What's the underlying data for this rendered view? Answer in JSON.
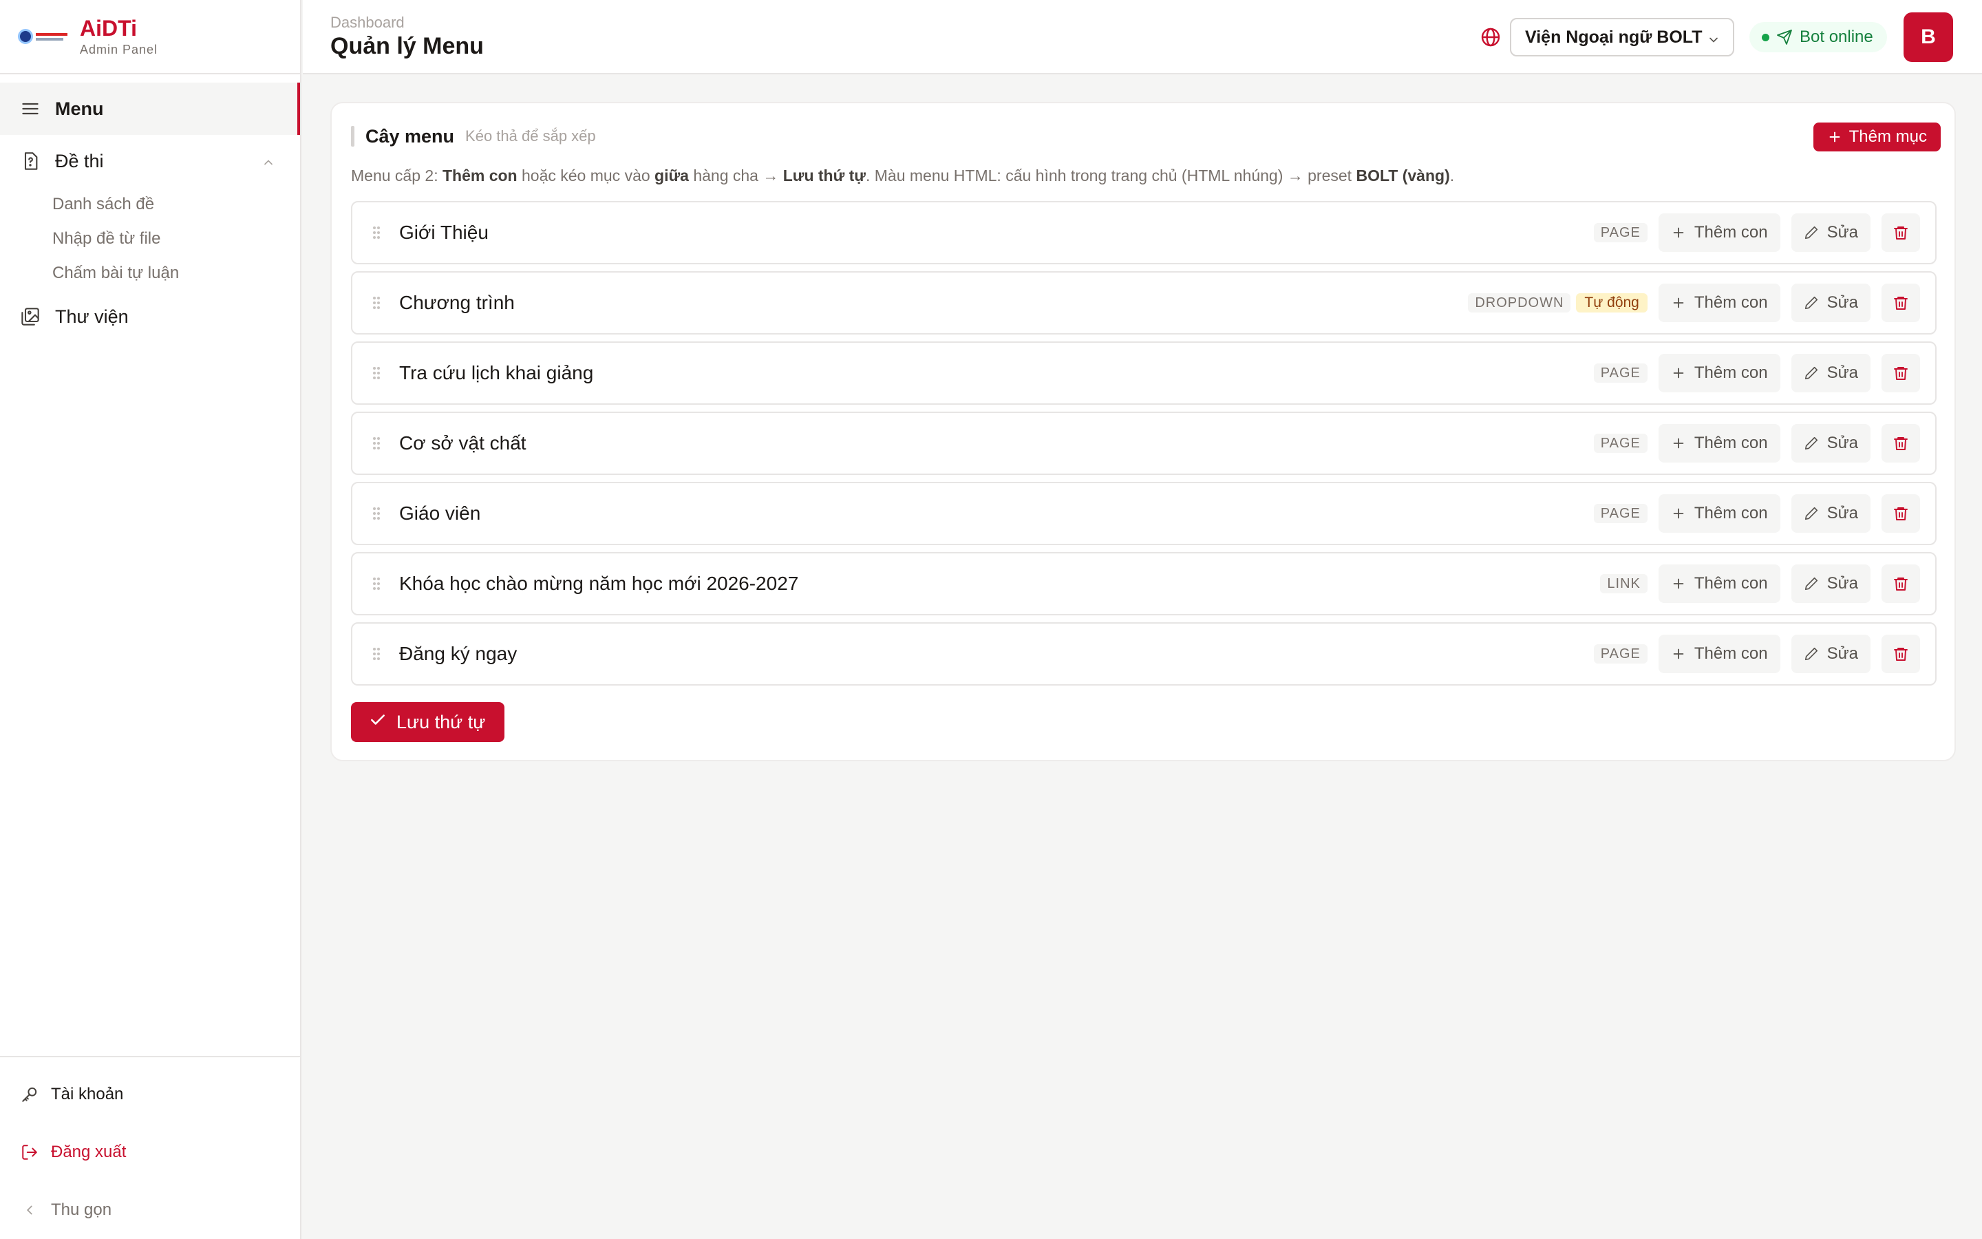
{
  "brand": {
    "logo": "AiDTi",
    "subtitle": "Admin Panel"
  },
  "sidebar": {
    "items": [
      {
        "label": "Menu",
        "icon": "menu-icon",
        "active": true
      },
      {
        "label": "Đề thi",
        "icon": "question-file-icon",
        "expanded": true,
        "children": [
          {
            "label": "Danh sách đề"
          },
          {
            "label": "Nhập đề từ file"
          },
          {
            "label": "Chấm bài tự luận"
          }
        ]
      },
      {
        "label": "Thư viện",
        "icon": "images-icon"
      }
    ],
    "bottom": {
      "account": "Tài khoản",
      "logout": "Đăng xuất",
      "collapse": "Thu gọn"
    }
  },
  "header": {
    "breadcrumb": "Dashboard",
    "title": "Quản lý Menu",
    "site_select": "Viện Ngoại ngữ BOLT",
    "bot_status": "Bot online",
    "avatar_initial": "B"
  },
  "card": {
    "title": "Cây menu",
    "hint": "Kéo thả để sắp xếp",
    "add_label": "Thêm mục",
    "note": {
      "p1": "Menu cấp 2: ",
      "b1": "Thêm con",
      "p2": " hoặc kéo mục vào ",
      "b2": "giữa",
      "p3": " hàng cha → ",
      "b3": "Lưu thứ tự",
      "p4": ". Màu menu HTML: cấu hình trong trang chủ (HTML nhúng) → preset ",
      "b4": "BOLT (vàng)",
      "p5": "."
    },
    "rows": [
      {
        "title": "Giới Thiệu",
        "type": "PAGE"
      },
      {
        "title": "Chương trình",
        "type": "DROPDOWN",
        "badge": "Tự động"
      },
      {
        "title": "Tra cứu lịch khai giảng",
        "type": "PAGE"
      },
      {
        "title": "Cơ sở vật chất",
        "type": "PAGE"
      },
      {
        "title": "Giáo viên",
        "type": "PAGE"
      },
      {
        "title": "Khóa học chào mừng năm học mới 2026-2027",
        "type": "LINK"
      },
      {
        "title": "Đăng ký ngay",
        "type": "PAGE"
      }
    ],
    "row_actions": {
      "add_child": "Thêm con",
      "edit": "Sửa"
    },
    "save_label": "Lưu thứ tự"
  },
  "colors": {
    "accent": "#c8102e",
    "online": "#15803d",
    "auto_badge_bg": "#fef3c7"
  }
}
